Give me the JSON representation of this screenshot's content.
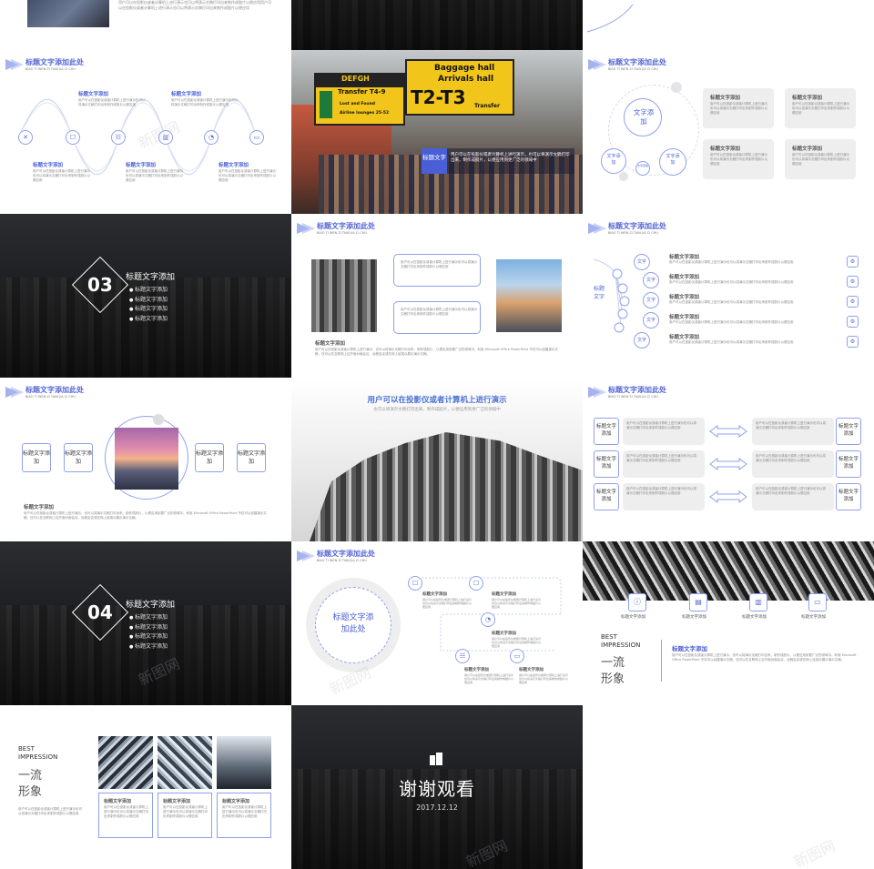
{
  "watermark": "新图网",
  "header": {
    "title": "标题文字添加此处",
    "subtitle": "BIAO TI WEN ZI TIAN JIA CI CHU"
  },
  "common": {
    "item_title": "标题文字添加",
    "body_short": "用户可以在投影仪或者计算机上进行演示也可以将演示文稿打印出来制作成胶片以便应用",
    "body_long": "用户可以在投影仪或者计算机上进行演示，也可以将演示文稿打印出来，制作成胶片，以便应用到更广泛的领域中。利用 Microsoft Office PowerPoint 不仅可以创建演示文稿，还可以在互联网上召开面对面会议、远程会议或在网上给观众展示演示文稿。"
  },
  "s1": {
    "text": "用户可以在投影仪或者计算机上进行演示也可以将演示文稿打印出来制作成胶片以便应用用户可以在投影仪或者计算机上进行演示也可以将演示文稿打印出来制作成胶片以便应用"
  },
  "s4": {
    "labels": [
      "标题文字添加",
      "标题文字添加",
      "标题文字添加",
      "标题文字添加",
      "标题文字添加"
    ]
  },
  "s5": {
    "sign1_top": "DEFGH",
    "sign1_sub": "Transfer T4-9",
    "sign1_lines": [
      "Lost and Found",
      "Airline lounges 25-52"
    ],
    "sign2_top": "Baggage hall",
    "sign2_mid": "Arrivals hall",
    "sign2_big": "T2-T3",
    "sign2_sub": "Transfer",
    "tag": "标题文字",
    "caption": "用户可以在投影仪或者计算机上进行演示，也可以将演示文稿打印出来，制作成胶片，以便应用到更广泛的领域中"
  },
  "s6": {
    "center": "文字添加",
    "small_left": "文字添加",
    "small_right": "文字添加",
    "tiny": "文字添加"
  },
  "s7": {
    "number": "03",
    "title": "标题文字添加",
    "bullets": [
      "标题文字添加",
      "标题文字添加",
      "标题文字添加",
      "标题文字添加"
    ]
  },
  "s9": {
    "root": "标题文字",
    "nodes": [
      "文字",
      "文字",
      "文字",
      "文字",
      "文字"
    ],
    "items": [
      "标题文字添加",
      "标题文字添加",
      "标题文字添加",
      "标题文字添加",
      "标题文字添加"
    ]
  },
  "s10": {
    "boxes": [
      "标题文字添加",
      "标题文字添加",
      "标题文字添加",
      "标题文字添加"
    ],
    "title": "标题文字添加"
  },
  "s11": {
    "title": "用户可以在投影仪或者计算机上进行演示",
    "subtitle": "也可以将演示文稿打印出来，制作成胶片，以便应用到更广泛的领域中"
  },
  "s12": {
    "boxes": [
      "标题文字添加",
      "标题文字添加",
      "标题文字添加",
      "标题文字添加",
      "标题文字添加",
      "标题文字添加"
    ]
  },
  "s13": {
    "number": "04",
    "title": "标题文字添加",
    "bullets": [
      "标题文字添加",
      "标题文字添加",
      "标题文字添加",
      "标题文字添加"
    ]
  },
  "s14": {
    "center": "标题文字添加此处",
    "items": [
      "标题文字添加",
      "标题文字添加",
      "标题文字添加",
      "标题文字添加",
      "标题文字添加",
      "标题文字添加"
    ]
  },
  "s15": {
    "icons": [
      "标题文字添加",
      "标题文字添加",
      "标题文字添加",
      "标题文字添加"
    ],
    "best": "BEST",
    "impression": "IMPRESSION",
    "cn1": "一流",
    "cn2": "形象",
    "title": "标题文字添加"
  },
  "s16": {
    "best": "BEST",
    "impression": "IMPRESSION",
    "cn1": "一流",
    "cn2": "形象",
    "cards": [
      "标题文字添加",
      "标题文字添加",
      "标题文字添加"
    ]
  },
  "s17": {
    "thanks": "谢谢观看",
    "date": "2017.12.12"
  }
}
